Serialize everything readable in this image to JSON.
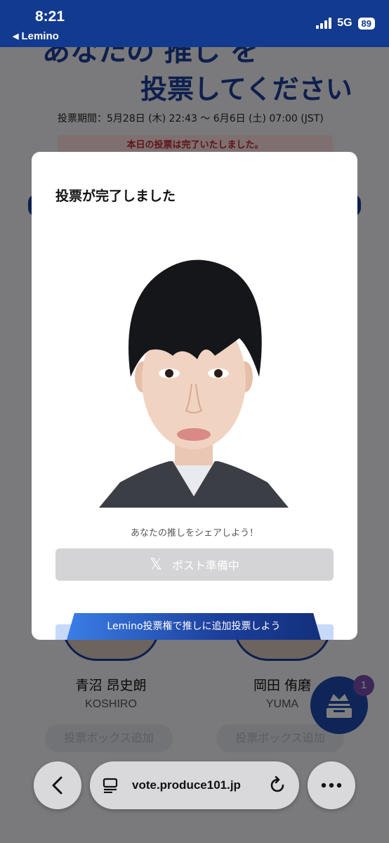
{
  "status_bar": {
    "time": "8:21",
    "back_app": "Lemino",
    "network": "5G",
    "battery": "89"
  },
  "page": {
    "hero_line1": "あなたの 推し を",
    "hero_line2": "投票してください",
    "vote_period": "投票期間：5月28日 (木) 22:43 〜 6月6日 (土) 07:00 (JST)",
    "done_notice": "本日の投票は完了いたしました。",
    "cards": [
      {
        "name": "青沼 昂史朗",
        "roma": "KOSHIRO",
        "add_label": "投票ボックス追加"
      },
      {
        "name": "岡田 侑磨",
        "roma": "YUMA",
        "add_label": "投票ボックス追加"
      }
    ],
    "ballot_badge": "1"
  },
  "modal": {
    "title": "投票が完了しました",
    "share_text": "あなたの推しをシェアしよう！",
    "post_button": "ポスト準備中",
    "extra_vote": "Lemino投票権で推しに追加投票しよう"
  },
  "browser": {
    "url": "vote.produce101.jp"
  },
  "colors": {
    "brand_blue": "#1d3f9c",
    "status_bar": "#123a8f",
    "disabled_button": "#d4d4d6"
  }
}
